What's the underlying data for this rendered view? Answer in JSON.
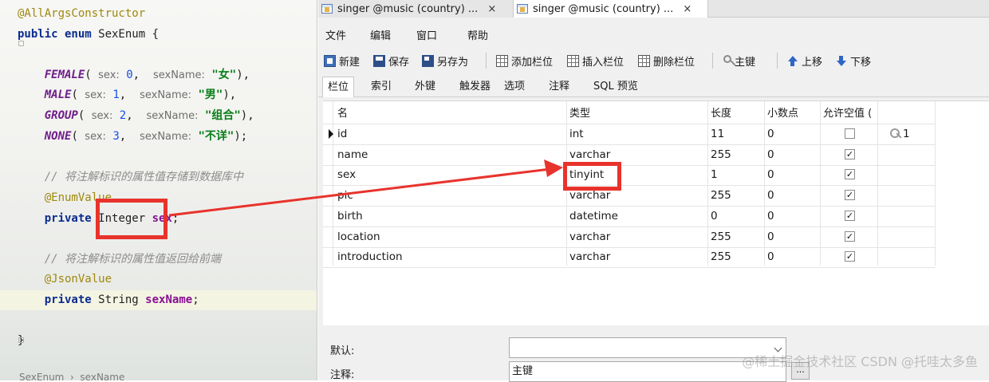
{
  "editor": {
    "lines": [
      {
        "parts": [
          {
            "c": "ann",
            "t": "@AllArgsConstructor"
          }
        ]
      },
      {
        "parts": [
          {
            "c": "kw",
            "t": "public enum"
          },
          {
            "c": "",
            "t": " SexEnum {"
          }
        ]
      },
      {
        "parts": [
          {
            "c": "",
            "t": "    "
          },
          {
            "c": "cst",
            "t": "FEMALE"
          },
          {
            "c": "",
            "t": "( "
          },
          {
            "c": "hint",
            "t": "sex:"
          },
          {
            "c": "",
            "t": " "
          },
          {
            "c": "num",
            "t": "0"
          },
          {
            "c": "",
            "t": ",  "
          },
          {
            "c": "hint",
            "t": "sexName:"
          },
          {
            "c": "",
            "t": " "
          },
          {
            "c": "str",
            "t": "\"女\""
          },
          {
            "c": "",
            "t": "),"
          }
        ]
      },
      {
        "parts": [
          {
            "c": "",
            "t": "    "
          },
          {
            "c": "cst",
            "t": "MALE"
          },
          {
            "c": "",
            "t": "( "
          },
          {
            "c": "hint",
            "t": "sex:"
          },
          {
            "c": "",
            "t": " "
          },
          {
            "c": "num",
            "t": "1"
          },
          {
            "c": "",
            "t": ",  "
          },
          {
            "c": "hint",
            "t": "sexName:"
          },
          {
            "c": "",
            "t": " "
          },
          {
            "c": "str",
            "t": "\"男\""
          },
          {
            "c": "",
            "t": "),"
          }
        ]
      },
      {
        "parts": [
          {
            "c": "",
            "t": "    "
          },
          {
            "c": "cst",
            "t": "GROUP"
          },
          {
            "c": "",
            "t": "( "
          },
          {
            "c": "hint",
            "t": "sex:"
          },
          {
            "c": "",
            "t": " "
          },
          {
            "c": "num",
            "t": "2"
          },
          {
            "c": "",
            "t": ",  "
          },
          {
            "c": "hint",
            "t": "sexName:"
          },
          {
            "c": "",
            "t": " "
          },
          {
            "c": "str",
            "t": "\"组合\""
          },
          {
            "c": "",
            "t": "),"
          }
        ]
      },
      {
        "parts": [
          {
            "c": "",
            "t": "    "
          },
          {
            "c": "cst",
            "t": "NONE"
          },
          {
            "c": "",
            "t": "( "
          },
          {
            "c": "hint",
            "t": "sex:"
          },
          {
            "c": "",
            "t": " "
          },
          {
            "c": "num",
            "t": "3"
          },
          {
            "c": "",
            "t": ",  "
          },
          {
            "c": "hint",
            "t": "sexName:"
          },
          {
            "c": "",
            "t": " "
          },
          {
            "c": "str",
            "t": "\"不详\""
          },
          {
            "c": "",
            "t": ");"
          }
        ]
      },
      {
        "parts": [
          {
            "c": "",
            "t": "    "
          },
          {
            "c": "cmt",
            "t": "// 将注解标识的属性值存储到数据库中"
          }
        ]
      },
      {
        "parts": [
          {
            "c": "",
            "t": "    "
          },
          {
            "c": "ann",
            "t": "@EnumValue"
          }
        ]
      },
      {
        "parts": [
          {
            "c": "",
            "t": "    "
          },
          {
            "c": "kw",
            "t": "private"
          },
          {
            "c": "",
            "t": " Integer "
          },
          {
            "c": "fld",
            "t": "sex"
          },
          {
            "c": "",
            "t": ";"
          }
        ]
      },
      {
        "parts": [
          {
            "c": "",
            "t": "    "
          },
          {
            "c": "cmt",
            "t": "// 将注解标识的属性值返回给前端"
          }
        ]
      },
      {
        "parts": [
          {
            "c": "",
            "t": "    "
          },
          {
            "c": "ann",
            "t": "@JsonValue"
          }
        ]
      },
      {
        "parts": [
          {
            "c": "",
            "t": "    "
          },
          {
            "c": "kw",
            "t": "private"
          },
          {
            "c": "",
            "t": " String "
          },
          {
            "c": "fld",
            "t": "sexName"
          },
          {
            "c": "",
            "t": ";"
          }
        ]
      },
      {
        "parts": [
          {
            "c": "",
            "t": "}"
          }
        ]
      }
    ],
    "breadcrumb": "SexEnum  ›  sexName"
  },
  "navicat": {
    "tabs": [
      {
        "label": "singer @music (country) ..."
      },
      {
        "label": "singer @music (country) ..."
      }
    ],
    "tab_close": "×",
    "menu": [
      "文件",
      "编辑",
      "窗口",
      "帮助"
    ],
    "toolbar": {
      "new": "新建",
      "save": "保存",
      "save_as": "另存为",
      "add_field": "添加栏位",
      "insert_field": "插入栏位",
      "delete_field": "删除栏位",
      "primary_key": "主键",
      "move_up": "上移",
      "move_down": "下移"
    },
    "subtabs": [
      "栏位",
      "索引",
      "外键",
      "触发器",
      "选项",
      "注释",
      "SQL 预览"
    ],
    "columns": [
      "名",
      "类型",
      "长度",
      "小数点",
      "允许空值 ("
    ],
    "rows": [
      {
        "name": "id",
        "type": "int",
        "length": "11",
        "decimals": "0",
        "nullable": false,
        "key": "1"
      },
      {
        "name": "name",
        "type": "varchar",
        "length": "255",
        "decimals": "0",
        "nullable": true,
        "key": ""
      },
      {
        "name": "sex",
        "type": "tinyint",
        "length": "1",
        "decimals": "0",
        "nullable": true,
        "key": ""
      },
      {
        "name": "pic",
        "type": "varchar",
        "length": "255",
        "decimals": "0",
        "nullable": true,
        "key": ""
      },
      {
        "name": "birth",
        "type": "datetime",
        "length": "0",
        "decimals": "0",
        "nullable": true,
        "key": ""
      },
      {
        "name": "location",
        "type": "varchar",
        "length": "255",
        "decimals": "0",
        "nullable": true,
        "key": ""
      },
      {
        "name": "introduction",
        "type": "varchar",
        "length": "255",
        "decimals": "0",
        "nullable": true,
        "key": ""
      }
    ],
    "properties": {
      "default_label": "默认:",
      "default_value": "",
      "comment_label": "注释:",
      "comment_value": "主键",
      "ellipsis": "..."
    },
    "watermark": "@稀土掘金技术社区 CSDN @托哇太多鱼"
  },
  "colors": {
    "annotation_red": "#e8332c"
  }
}
